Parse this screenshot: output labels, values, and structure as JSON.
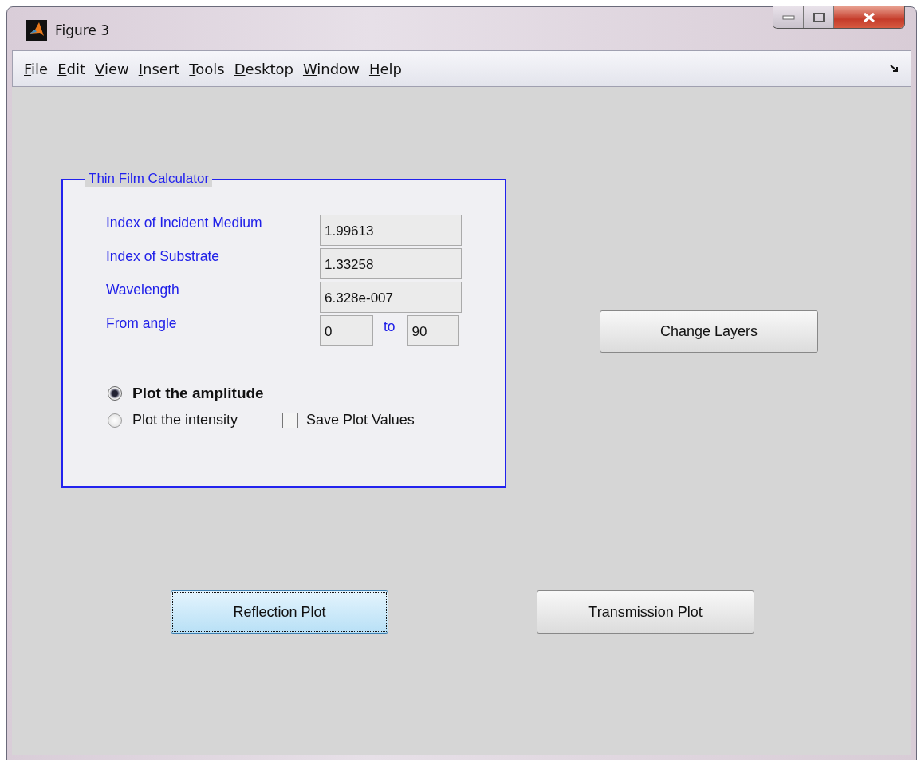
{
  "window": {
    "title": "Figure 3"
  },
  "menu": [
    {
      "label": "File"
    },
    {
      "label": "Edit"
    },
    {
      "label": "View"
    },
    {
      "label": "Insert"
    },
    {
      "label": "Tools"
    },
    {
      "label": "Desktop"
    },
    {
      "label": "Window"
    },
    {
      "label": "Help"
    }
  ],
  "panel": {
    "title": "Thin Film Calculator",
    "fields": [
      {
        "label": "Index of Incident Medium",
        "value": "1.99613"
      },
      {
        "label": "Index of Substrate",
        "value": "1.33258"
      },
      {
        "label": "Wavelength",
        "value": "6.328e-007"
      }
    ],
    "angle": {
      "label": "From angle",
      "from": "0",
      "separator": "to",
      "to": "90"
    },
    "radios": [
      {
        "label": "Plot the amplitude",
        "selected": true
      },
      {
        "label": "Plot the intensity",
        "selected": false
      }
    ],
    "checkbox": {
      "label": "Save Plot Values",
      "checked": false
    }
  },
  "buttons": [
    {
      "label": "Change Layers",
      "focused": false
    },
    {
      "label": "Reflection Plot",
      "focused": true
    },
    {
      "label": "Transmission Plot",
      "focused": false
    }
  ]
}
